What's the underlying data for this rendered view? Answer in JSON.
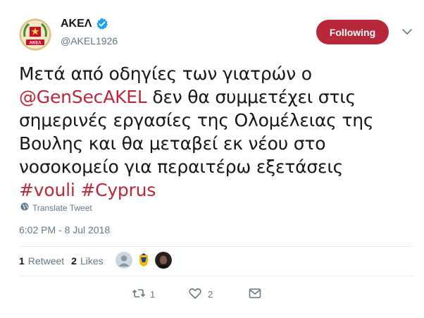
{
  "account": {
    "name": "ΑΚΕΛ",
    "handle": "@AKEL1926",
    "avatar_label": "ΑΚΕΛ",
    "verified": true
  },
  "follow_button": {
    "label": "Following",
    "color": "#b9283a"
  },
  "tweet": {
    "text_before": "Μετά από οδηγίες των γιατρών ο",
    "mention": "@GenSecAKEL",
    "text_after": " δεν θα συμμετέχει στις σημερινές εργασίες της Ολομέλειας της Βουλης και θα μεταβεί εκ νέου στο νοσοκομείο για περαιτέρω εξετάσεις",
    "hashtag_1": "#vouli",
    "hashtag_2": "#Cyprus",
    "link_color": "#b9283a"
  },
  "translate_label": "Translate Tweet",
  "timestamp": "6:02 PM - 8 Jul 2018",
  "stats": {
    "retweets_count": "1",
    "retweets_label": "Retweet",
    "likes_count": "2",
    "likes_label": "Likes"
  },
  "actions": {
    "reply_icon": "reply-icon",
    "retweet_count": "1",
    "like_count": "2",
    "message_icon": "envelope-icon"
  }
}
